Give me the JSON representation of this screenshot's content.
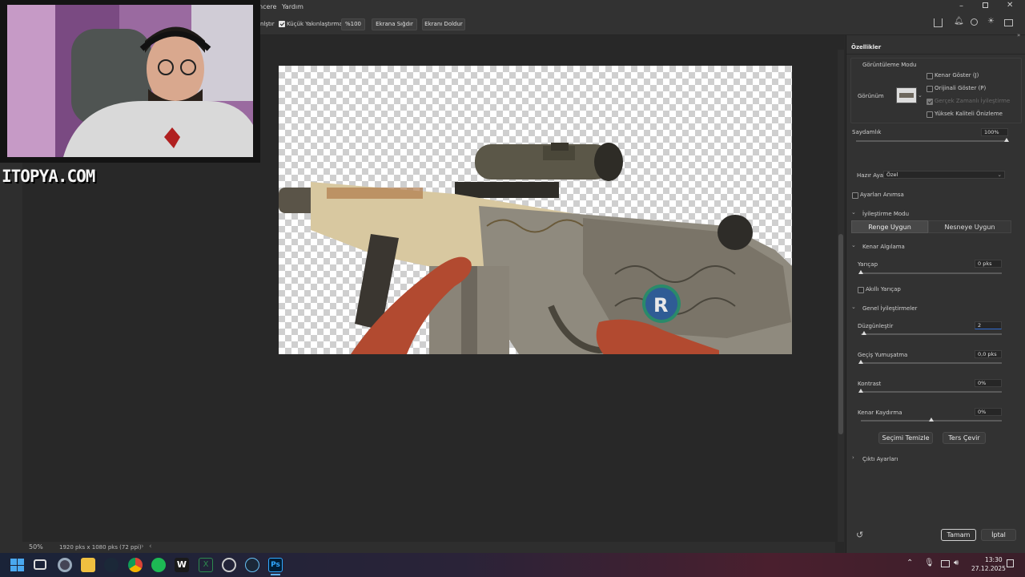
{
  "menubar": {
    "items": [
      "ncere",
      "Yardım"
    ],
    "window_controls": [
      "minimize-icon",
      "restore-icon",
      "close-icon"
    ]
  },
  "options_bar": {
    "partial_label": "nlştır",
    "small_zoom_checkbox": {
      "label": "Küçük Yakınlaştırma",
      "checked": true
    },
    "zoom_100_button": "%100",
    "fit_screen_button": "Ekrana Sığdır",
    "fill_screen_button": "Ekranı Doldur"
  },
  "watermark": {
    "text": "ITOPYA.COM"
  },
  "status": {
    "zoom": "50%",
    "doc_info": "1920 pks x 1080 pks (72 ppi)"
  },
  "panel": {
    "title": "Özellikler",
    "view_mode": {
      "heading": "Görüntüleme Modu",
      "view_label": "Görünüm",
      "options": [
        {
          "label": "Kenar Göster (J)",
          "checked": false,
          "disabled": false
        },
        {
          "label": "Orijinali Göster (P)",
          "checked": false,
          "disabled": false
        },
        {
          "label": "Gerçek Zamanlı İyileştirme",
          "checked": true,
          "disabled": true
        },
        {
          "label": "Yüksek Kaliteli Önizleme",
          "checked": false,
          "disabled": false
        }
      ]
    },
    "opacity": {
      "label": "Saydamlık",
      "value": "100%",
      "fraction": 1.0
    },
    "preset": {
      "label": "Hazır Ayar",
      "value": "Özel"
    },
    "remember": {
      "label": "Ayarları Anımsa",
      "checked": false
    },
    "refine_mode": {
      "heading": "İyileştirme Modu",
      "tab_color": "Renge Uygun",
      "tab_object": "Nesneye Uygun",
      "active": "Renge Uygun"
    },
    "edge_detection": {
      "heading": "Kenar Algılama",
      "radius": {
        "label": "Yarıçap",
        "value": "0 pks",
        "fraction": 0.0
      },
      "smart_radius": {
        "label": "Akıllı Yarıçap",
        "checked": false
      }
    },
    "global": {
      "heading": "Genel İyileştirmeler",
      "smooth": {
        "label": "Düzgünleştir",
        "value": "2",
        "fraction": 0.02
      },
      "feather": {
        "label": "Geçiş Yumuşatma",
        "value": "0,0 pks",
        "fraction": 0.0
      },
      "contrast": {
        "label": "Kontrast",
        "value": "0%",
        "fraction": 0.0
      },
      "shift_edge": {
        "label": "Kenar Kaydırma",
        "value": "0%",
        "fraction": 0.5
      }
    },
    "clear_selection_button": "Seçimi Temizle",
    "invert_button": "Ters Çevir",
    "output": {
      "heading": "Çıktı Ayarları"
    },
    "ok_button": "Tamam",
    "cancel_button": "İptal"
  },
  "taskbar": {
    "time": "13:30",
    "date": "27.12.2025",
    "apps": [
      "windows-start-icon",
      "task-view-icon",
      "settings-icon",
      "file-explorer-icon",
      "steam-icon",
      "chrome-icon",
      "spotify-icon",
      "word-icon",
      "excel-icon",
      "circle-app-icon",
      "steam-icon-2",
      "photoshop-icon"
    ],
    "photoshop_label": "Ps"
  },
  "colors": {
    "accent": "#2f6bd0",
    "panel_bg": "#323232",
    "workspace_bg": "#282828"
  }
}
